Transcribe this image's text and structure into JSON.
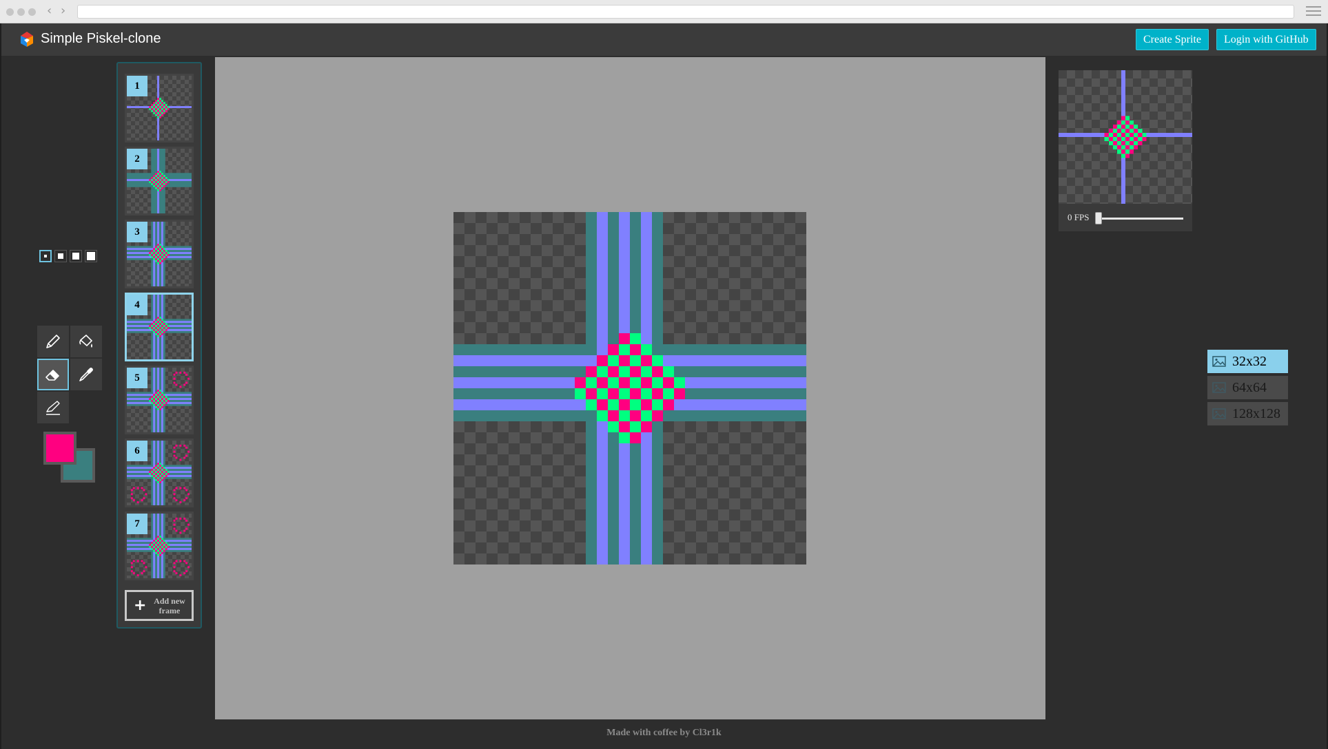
{
  "app": {
    "title": "Simple Piskel-clone"
  },
  "header": {
    "create_label": "Create Sprite",
    "login_label": "Login with GitHub"
  },
  "tools": {
    "pen_sizes": 4,
    "items": [
      "pen-tool",
      "paint-bucket-tool",
      "eraser-tool",
      "color-picker-tool",
      "stroke-tool"
    ],
    "active": "eraser-tool",
    "primary_color": "#ff0080",
    "secondary_color": "#3a7f7f"
  },
  "frames": {
    "items": [
      {
        "number": "1"
      },
      {
        "number": "2"
      },
      {
        "number": "3"
      },
      {
        "number": "4",
        "active": true
      },
      {
        "number": "5"
      },
      {
        "number": "6"
      },
      {
        "number": "7"
      }
    ],
    "add_label": "Add new frame"
  },
  "preview": {
    "fps_label": "0 FPS",
    "fps": 0
  },
  "sizes": {
    "options": [
      "32x32",
      "64x64",
      "128x128"
    ],
    "active": "32x32"
  },
  "colors": {
    "accent": "#00b2c9",
    "selection": "#8ad0ec",
    "magenta": "#ff0080",
    "green": "#00ff80",
    "violet": "#8080ff",
    "teal": "#3a7f7f"
  },
  "footer": {
    "text": "Made with coffee by Cl3r1k"
  }
}
